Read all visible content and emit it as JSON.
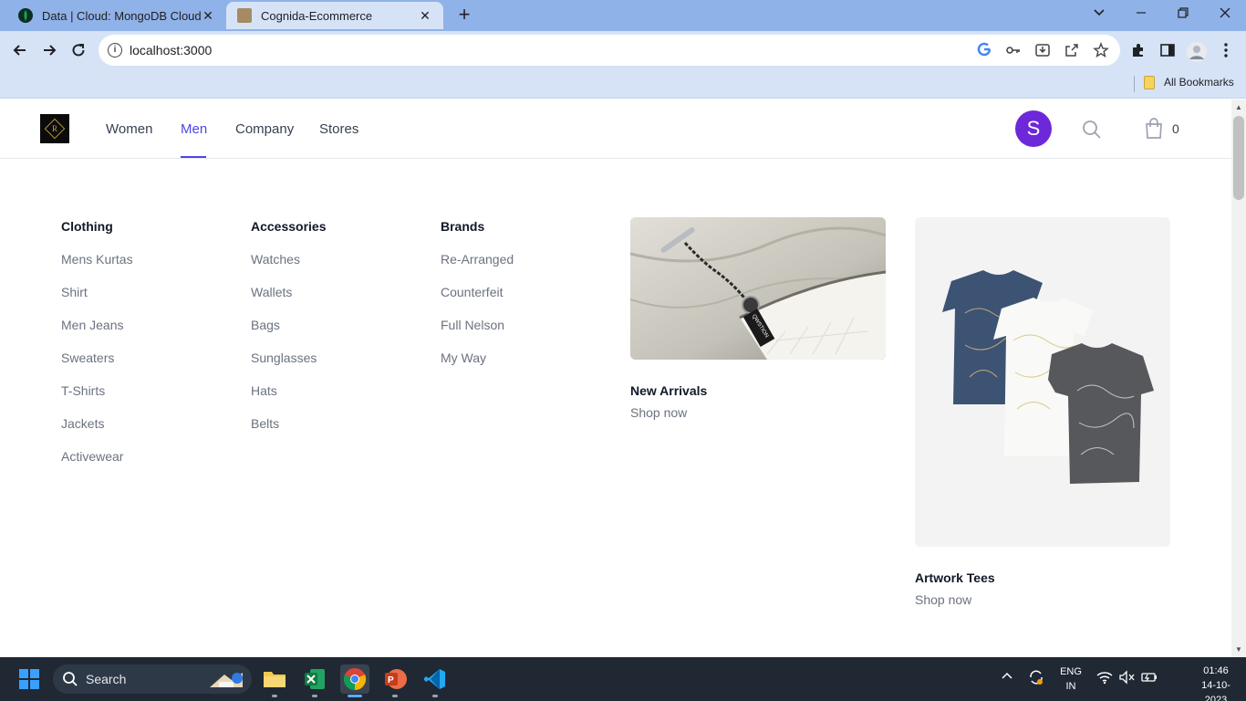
{
  "browser": {
    "tabs": [
      {
        "title": "Data | Cloud: MongoDB Cloud",
        "favicon": "mongodb-leaf-icon"
      },
      {
        "title": "Cognida-Ecommerce",
        "favicon": "site-favicon"
      }
    ],
    "url": "localhost:3000",
    "bookmarks_label": "All Bookmarks"
  },
  "site": {
    "nav": [
      "Women",
      "Men",
      "Company",
      "Stores"
    ],
    "active_nav": "Men",
    "avatar_letter": "S",
    "cart_count": "0",
    "accent_color": "#4f46e5",
    "avatar_color": "#6d28d9"
  },
  "menu": {
    "columns": [
      {
        "title": "Clothing",
        "items": [
          "Mens Kurtas",
          "Shirt",
          "Men Jeans",
          "Sweaters",
          "T-Shirts",
          "Jackets",
          "Activewear"
        ]
      },
      {
        "title": "Accessories",
        "items": [
          "Watches",
          "Wallets",
          "Bags",
          "Sunglasses",
          "Hats",
          "Belts"
        ]
      },
      {
        "title": "Brands",
        "items": [
          "Re-Arranged",
          "Counterfeit",
          "Full Nelson",
          "My Way"
        ]
      }
    ],
    "featured": [
      {
        "title": "New Arrivals",
        "cta": "Shop now",
        "tag_text": "QWSTION"
      },
      {
        "title": "Artwork Tees",
        "cta": "Shop now"
      }
    ]
  },
  "taskbar": {
    "search_label": "Search",
    "lang_line1": "ENG",
    "lang_line2": "IN",
    "time": "01:46",
    "date": "14-10-2023"
  }
}
